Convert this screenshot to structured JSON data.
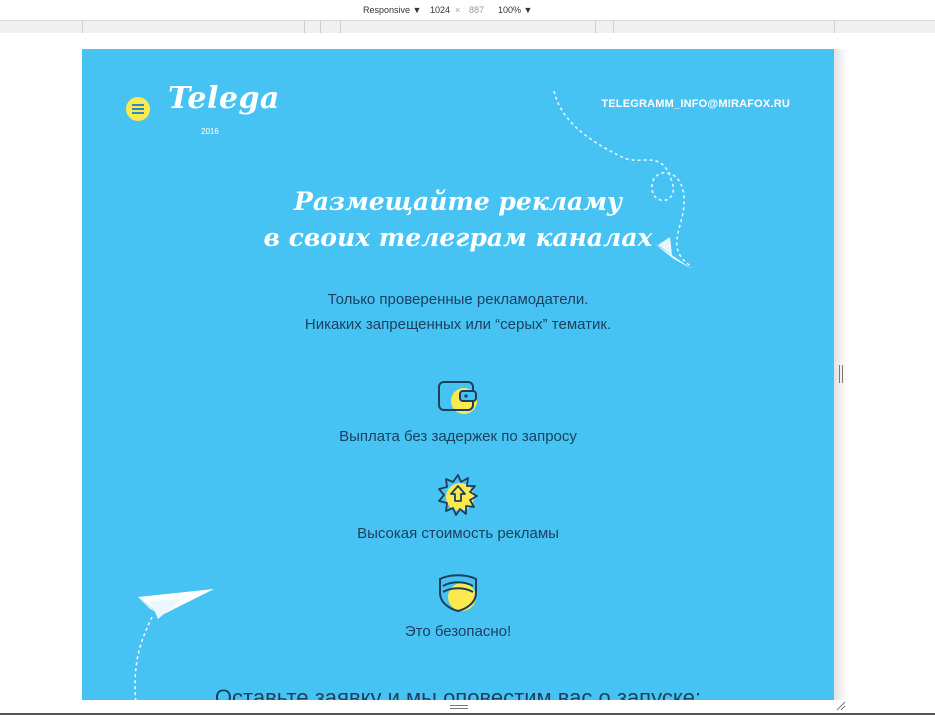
{
  "devtools": {
    "device_mode": "Responsive",
    "width": "1024",
    "times": "×",
    "height": "887",
    "zoom": "100%"
  },
  "site": {
    "logo": "Telega",
    "year": "2016",
    "email": "TELEGRAMM_INFO@MIRAFOX.RU",
    "headline_line1": "Размещайте рекламу",
    "headline_line2": "в своих телеграм каналах",
    "subtitle_line1": "Только проверенные рекламодатели.",
    "subtitle_line2": "Никаких запрещенных или “серых” тематик.",
    "features": [
      {
        "icon": "wallet-icon",
        "label": "Выплата без задержек по запросу"
      },
      {
        "icon": "badge-arrow-icon",
        "label": "Высокая стоимость рекламы"
      },
      {
        "icon": "shield-icon",
        "label": "Это безопасно!"
      }
    ],
    "cta": "Оставьте заявку и мы оповестим вас о запуске:"
  },
  "colors": {
    "background": "#47c3f3",
    "accent_yellow": "#fce94f",
    "text_dark": "#1c3f5e",
    "white": "#ffffff"
  }
}
